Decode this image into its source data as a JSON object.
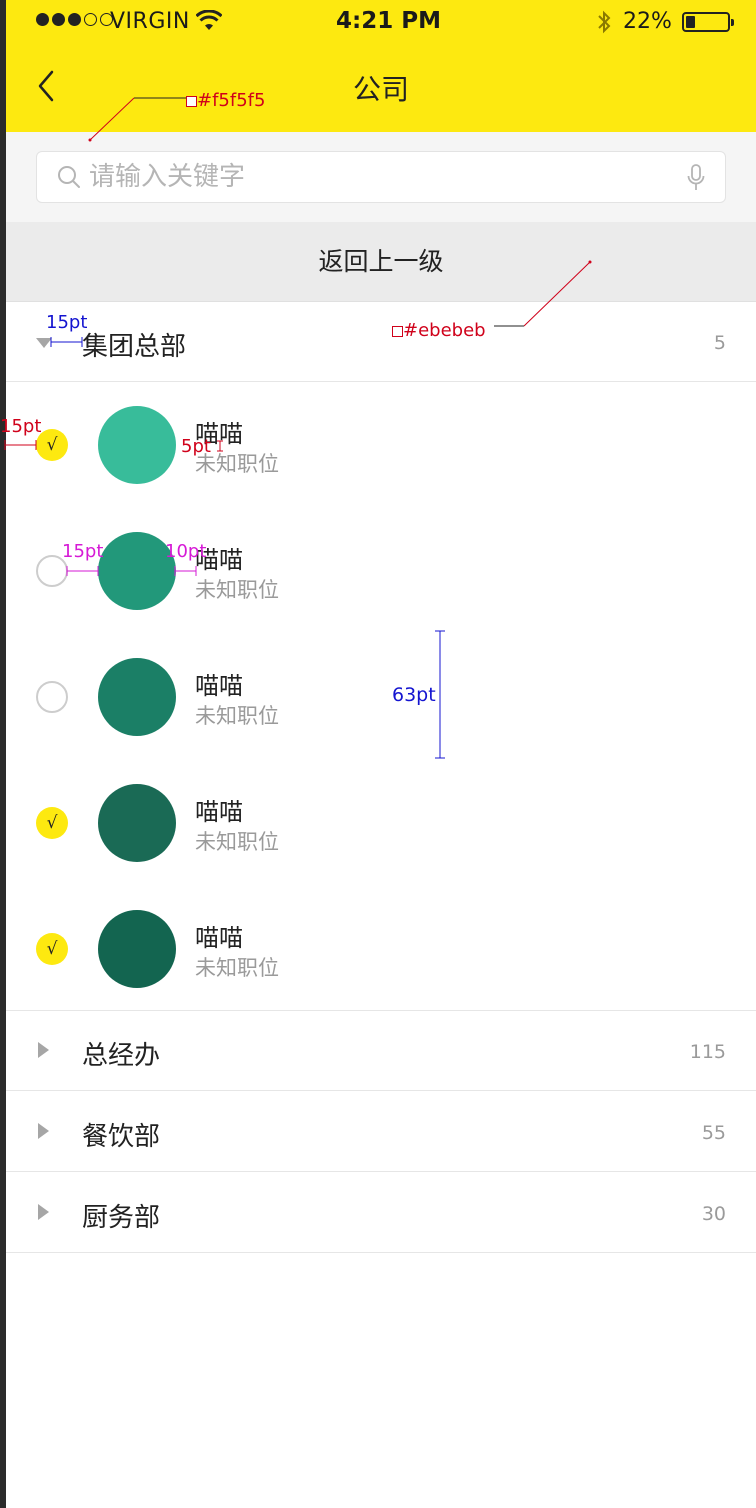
{
  "status": {
    "carrier": "VIRGIN",
    "time": "4:21 PM",
    "battery": "22%"
  },
  "nav": {
    "title": "公司"
  },
  "search": {
    "placeholder": "请输入关键字",
    "value": ""
  },
  "back_up_label": "返回上一级",
  "expanded_group": {
    "name": "集团总部",
    "count": "5"
  },
  "members": [
    {
      "name": "喵喵",
      "title": "未知职位",
      "checked": true,
      "avatar_color": "#38bc9a"
    },
    {
      "name": "喵喵",
      "title": "未知职位",
      "checked": false,
      "avatar_color": "#22987a"
    },
    {
      "name": "喵喵",
      "title": "未知职位",
      "checked": false,
      "avatar_color": "#1b7f66"
    },
    {
      "name": "喵喵",
      "title": "未知职位",
      "checked": true,
      "avatar_color": "#1a6a55"
    },
    {
      "name": "喵喵",
      "title": "未知职位",
      "checked": true,
      "avatar_color": "#136550"
    }
  ],
  "check_mark": "√",
  "groups": [
    {
      "name": "总经办",
      "count": "115"
    },
    {
      "name": "餐饮部",
      "count": "55"
    },
    {
      "name": "厨务部",
      "count": "30"
    }
  ],
  "annotations": {
    "color_search_bg": "#f5f5f5",
    "color_back_bg": "#ebebeb",
    "indent_triangle": "15pt",
    "indent_check": "15pt",
    "gap_check_text": "5pt",
    "gap_check_avatar": "15pt",
    "gap_avatar_text": "10pt",
    "row_height": "63pt"
  },
  "colors": {
    "header_yellow": "#fde910",
    "check_yellow": "#fde910"
  }
}
